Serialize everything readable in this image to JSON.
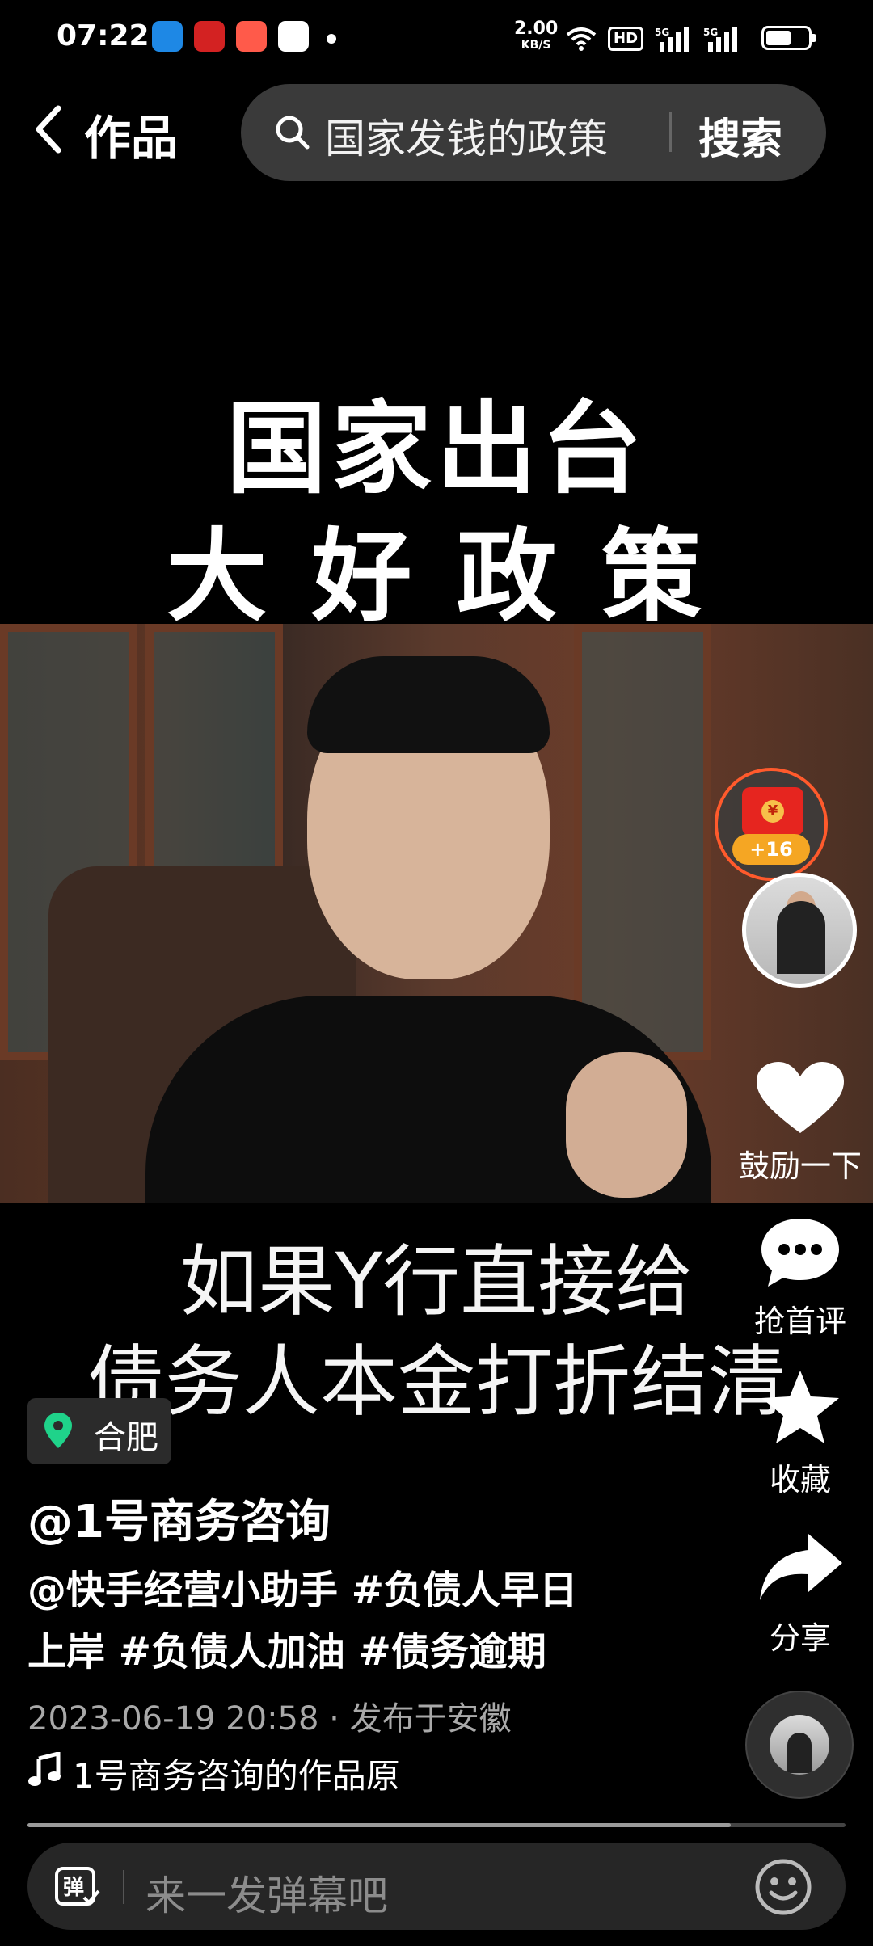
{
  "status_bar": {
    "time": "07:22",
    "net_speed": "2.00",
    "net_unit": "KB/S",
    "icons": [
      "signal-hd-icon",
      "5g-signal-icon",
      "5g-signal-icon",
      "battery-icon"
    ]
  },
  "header": {
    "back_icon": "chevron-left-icon",
    "title": "作品",
    "search_text": "国家发钱的政策",
    "search_button": "搜索"
  },
  "video": {
    "overlay_line1": "国家出台",
    "overlay_line2": "大 好 政 策",
    "subtitle_line1": "如果Y行直接给",
    "subtitle_line2": "债务人本金打折结清"
  },
  "actions": {
    "redpacket_badge": "+16",
    "like_label": "鼓励一下",
    "comment_label": "抢首评",
    "favorite_label": "收藏",
    "share_label": "分享"
  },
  "post": {
    "location": "合肥",
    "author": "@1号商务咨询",
    "desc_line1": "@快手经营小助手 #负债人早日",
    "desc_line2": "上岸 #负债人加油 #债务逾期",
    "meta": "2023-06-19 20:58 · 发布于安徽",
    "music": "1号商务咨询的作品原"
  },
  "playback": {
    "progress": 0.86
  },
  "comment_bar": {
    "placeholder": "来一发弹幕吧"
  },
  "colors": {
    "accent_location": "#1fd38a",
    "redpacket": "#e6251f",
    "badge": "#f5a623"
  }
}
